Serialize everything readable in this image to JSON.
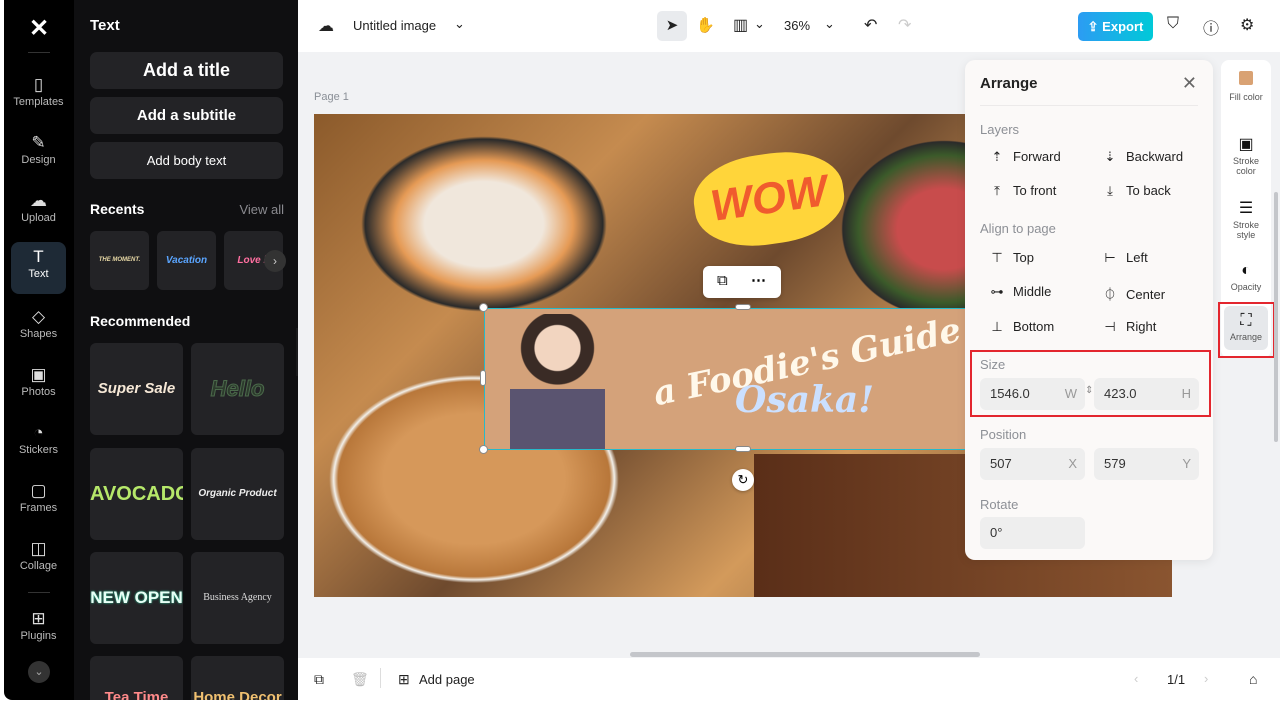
{
  "app": {
    "logo": "capcut-logo"
  },
  "rail": {
    "items": [
      {
        "label": "Templates",
        "icon": "templates-icon"
      },
      {
        "label": "Design",
        "icon": "design-icon"
      },
      {
        "label": "Upload",
        "icon": "upload-icon"
      },
      {
        "label": "Text",
        "icon": "text-icon",
        "active": true
      },
      {
        "label": "Shapes",
        "icon": "shapes-icon"
      },
      {
        "label": "Photos",
        "icon": "photos-icon"
      },
      {
        "label": "Stickers",
        "icon": "stickers-icon"
      },
      {
        "label": "Frames",
        "icon": "frames-icon"
      },
      {
        "label": "Collage",
        "icon": "collage-icon"
      },
      {
        "label": "Plugins",
        "icon": "plugins-icon"
      }
    ]
  },
  "panel": {
    "title": "Text",
    "add_title": "Add a title",
    "add_subtitle": "Add a subtitle",
    "add_body": "Add body text",
    "recents": "Recents",
    "view_all": "View all",
    "recent_items": [
      "THE MOMENT.",
      "Vacation",
      "Love it"
    ],
    "recommended": "Recommended",
    "presets": [
      "Super Sale",
      "Hello",
      "AVOCADO",
      "Organic Product",
      "NEW OPEN",
      "Business Agency",
      "Tea Time",
      "Home Decor"
    ]
  },
  "topbar": {
    "doc_title": "Untitled image",
    "zoom": "36%",
    "export": "Export"
  },
  "canvas": {
    "page_label": "Page 1",
    "sticker": "WOW",
    "banner_line1": "a Foodie's Guide to",
    "banner_line2": "Osaka!"
  },
  "arrange": {
    "title": "Arrange",
    "layers_label": "Layers",
    "layers": [
      "Forward",
      "Backward",
      "To front",
      "To back"
    ],
    "align_label": "Align to page",
    "align": [
      "Top",
      "Left",
      "Middle",
      "Center",
      "Bottom",
      "Right"
    ],
    "size_label": "Size",
    "width": "1546.0",
    "width_unit": "W",
    "height": "423.0",
    "height_unit": "H",
    "position_label": "Position",
    "x": "507",
    "x_unit": "X",
    "y": "579",
    "y_unit": "Y",
    "rotate_label": "Rotate",
    "rotate": "0°"
  },
  "sidebar": {
    "items": [
      {
        "label": "Fill color",
        "color": "#d9a273"
      },
      {
        "label": "Stroke color"
      },
      {
        "label": "Stroke style"
      },
      {
        "label": "Opacity"
      },
      {
        "label": "Arrange",
        "active": true
      }
    ]
  },
  "bottombar": {
    "add_page": "Add page",
    "page_count": "1/1"
  },
  "colors": {
    "accent": "#00c9d8",
    "highlight": "#e3262e",
    "selection": "#27b9c9"
  }
}
